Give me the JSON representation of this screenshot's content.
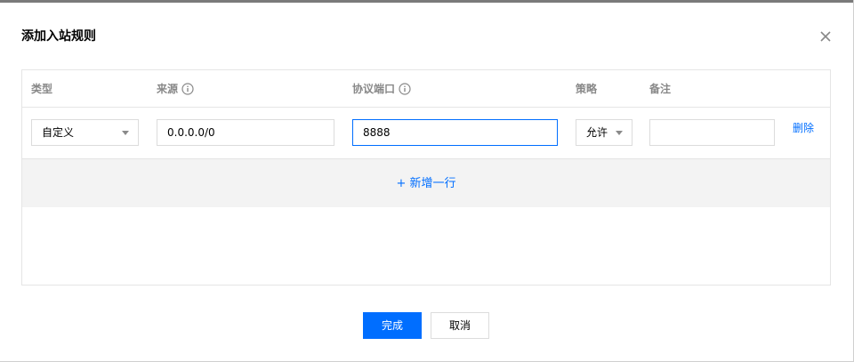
{
  "dialog": {
    "title": "添加入站规则",
    "close_icon": "close-icon"
  },
  "table": {
    "columns": {
      "type": "类型",
      "source": "来源",
      "port": "协议端口",
      "policy": "策略",
      "note": "备注"
    },
    "info_icon": "info-circle-icon",
    "rows": [
      {
        "type": "自定义",
        "source": "0.0.0.0/0",
        "port": "8888",
        "policy": "允许",
        "note": "",
        "delete_label": "删除"
      }
    ],
    "add_row_label": "+ 新增一行"
  },
  "footer": {
    "confirm_label": "完成",
    "cancel_label": "取消"
  },
  "colors": {
    "accent": "#006eff",
    "border": "#e5e5e5",
    "add_row_bg": "#f3f3f3"
  }
}
